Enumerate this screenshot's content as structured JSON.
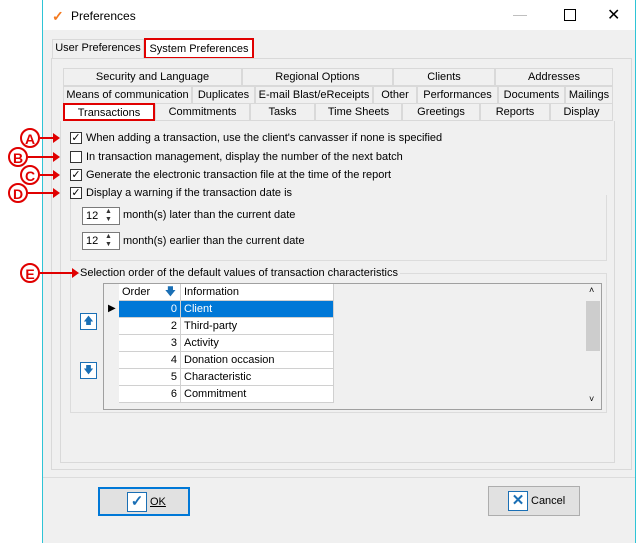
{
  "window": {
    "title": "Preferences"
  },
  "top_tabs": [
    {
      "label": "User Preferences"
    },
    {
      "label": "System Preferences"
    }
  ],
  "tabs_row1": [
    {
      "label": "Security and Language"
    },
    {
      "label": "Regional Options"
    },
    {
      "label": "Clients"
    },
    {
      "label": "Addresses"
    }
  ],
  "tabs_row2": [
    {
      "label": "Means of communication"
    },
    {
      "label": "Duplicates"
    },
    {
      "label": "E-mail Blast/eReceipts"
    },
    {
      "label": "Other"
    },
    {
      "label": "Performances"
    },
    {
      "label": "Documents"
    },
    {
      "label": "Mailings"
    }
  ],
  "tabs_row3": [
    {
      "label": "Transactions"
    },
    {
      "label": "Commitments"
    },
    {
      "label": "Tasks"
    },
    {
      "label": "Time Sheets"
    },
    {
      "label": "Greetings"
    },
    {
      "label": "Reports"
    },
    {
      "label": "Display"
    }
  ],
  "options": [
    {
      "label": "When adding a transaction, use the client's canvasser if none is specified",
      "checked": true,
      "marker": "A"
    },
    {
      "label": "In transaction management, display the number of the next batch",
      "checked": false,
      "marker": "B"
    },
    {
      "label": "Generate the electronic transaction file at the time of the report",
      "checked": true,
      "marker": "C"
    },
    {
      "label": "Display a warning if the transaction date is",
      "checked": true,
      "marker": "D"
    }
  ],
  "warning": {
    "later_value": "12",
    "later_label": "month(s) later than the current date",
    "earlier_value": "12",
    "earlier_label": "month(s) earlier than the current date"
  },
  "selection": {
    "marker": "E",
    "title": "Selection order of the default values of transaction characteristics",
    "headers": {
      "order": "Order",
      "information": "Information"
    },
    "rows": [
      {
        "order": "0",
        "info": "Client",
        "selected": true
      },
      {
        "order": "2",
        "info": "Third-party"
      },
      {
        "order": "3",
        "info": "Activity"
      },
      {
        "order": "4",
        "info": "Donation occasion"
      },
      {
        "order": "5",
        "info": "Characteristic"
      },
      {
        "order": "6",
        "info": "Commitment"
      }
    ]
  },
  "buttons": {
    "ok": "OK",
    "cancel": "Cancel"
  },
  "colors": {
    "annotation": "#e00000",
    "selection": "#0078d7",
    "icon_blue": "#1a6fb5"
  }
}
